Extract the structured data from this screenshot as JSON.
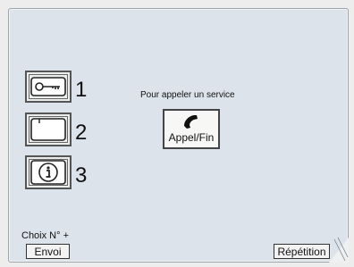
{
  "shortcuts": [
    {
      "icon": "key-icon",
      "number": "1"
    },
    {
      "icon": "card-icon",
      "number": "2"
    },
    {
      "icon": "info-icon",
      "number": "3"
    }
  ],
  "service_prompt": "Pour appeler un service",
  "call_button": {
    "icon": "phone-icon",
    "label": "Appel/Fin"
  },
  "choice_label": "Choix N° +",
  "send_button": "Envoi",
  "repeat_button": "Répétition"
}
